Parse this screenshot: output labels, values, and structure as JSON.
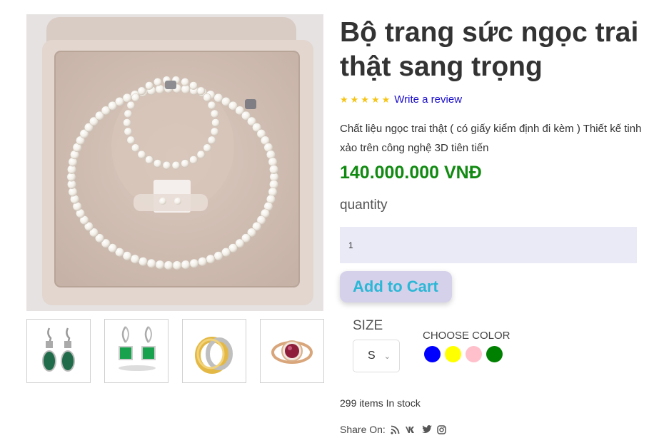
{
  "product": {
    "title": "Bộ trang sức ngọc trai thật sang trọng",
    "rating_stars": "★★★★★",
    "review_link": "Write a review",
    "description": "Chất liệu ngọc trai thật ( có giấy kiểm định đi kèm ) Thiết kế tinh xảo trên công nghệ 3D tiên tiến",
    "price": "140.000.000 VNĐ",
    "quantity_label": "quantity",
    "quantity_value": "1",
    "add_to_cart": "Add to Cart",
    "size_label": "SIZE",
    "size_selected": "S",
    "color_label": "CHOOSE COLOR",
    "colors": [
      "#0000ff",
      "#ffff00",
      "#ffc0cb",
      "#008000"
    ],
    "stock": "299 items In stock",
    "share_label": "Share On:"
  },
  "gallery": {
    "main_image": "pearl-jewelry-set-image",
    "thumbnails": [
      "emerald-drop-earrings",
      "emerald-teardrop-earrings",
      "gold-silver-ring",
      "ruby-halo-ring"
    ]
  },
  "share_icons": [
    "rss-icon",
    "vk-icon",
    "twitter-icon",
    "instagram-icon"
  ],
  "colors": {
    "price": "#118a11",
    "stars": "#f5c518",
    "link": "#1a0dcc",
    "add_to_cart_text": "#2bb7d6",
    "add_to_cart_bg": "#d6d1ea",
    "quantity_bg": "#e9eaf5"
  }
}
